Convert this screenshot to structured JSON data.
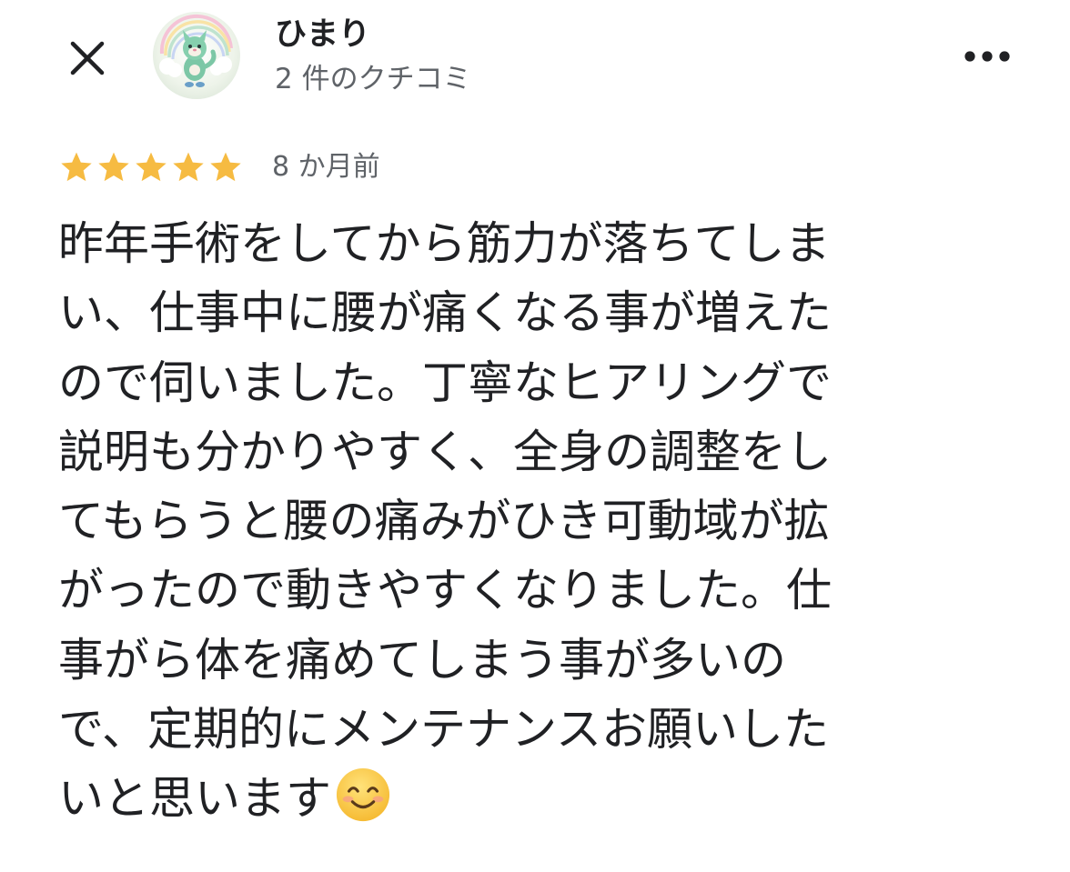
{
  "header": {
    "close_icon": "close-icon",
    "avatar_icon": "user-avatar",
    "user_name": "ひまり",
    "review_count": "2 件のクチコミ",
    "more_icon": "more-horizontal-icon"
  },
  "review": {
    "rating": 5,
    "rating_max": 5,
    "star_color": "#f6bb42",
    "date": "8 か月前",
    "lines": [
      "昨年手術をしてから筋力が落ちてしま",
      "い、仕事中に腰が痛くなる事が増えた",
      "ので伺いました。丁寧なヒアリングで",
      "説明も分かりやすく、全身の調整をし",
      "てもらうと腰の痛みがひき可動域が拡",
      "がったので動きやすくなりました。仕",
      "事がら体を痛めてしまう事が多いの",
      "で、定期的にメンテナンスお願いした",
      "いと思います"
    ],
    "trailing_emoji": "smiling-face-emoji"
  }
}
